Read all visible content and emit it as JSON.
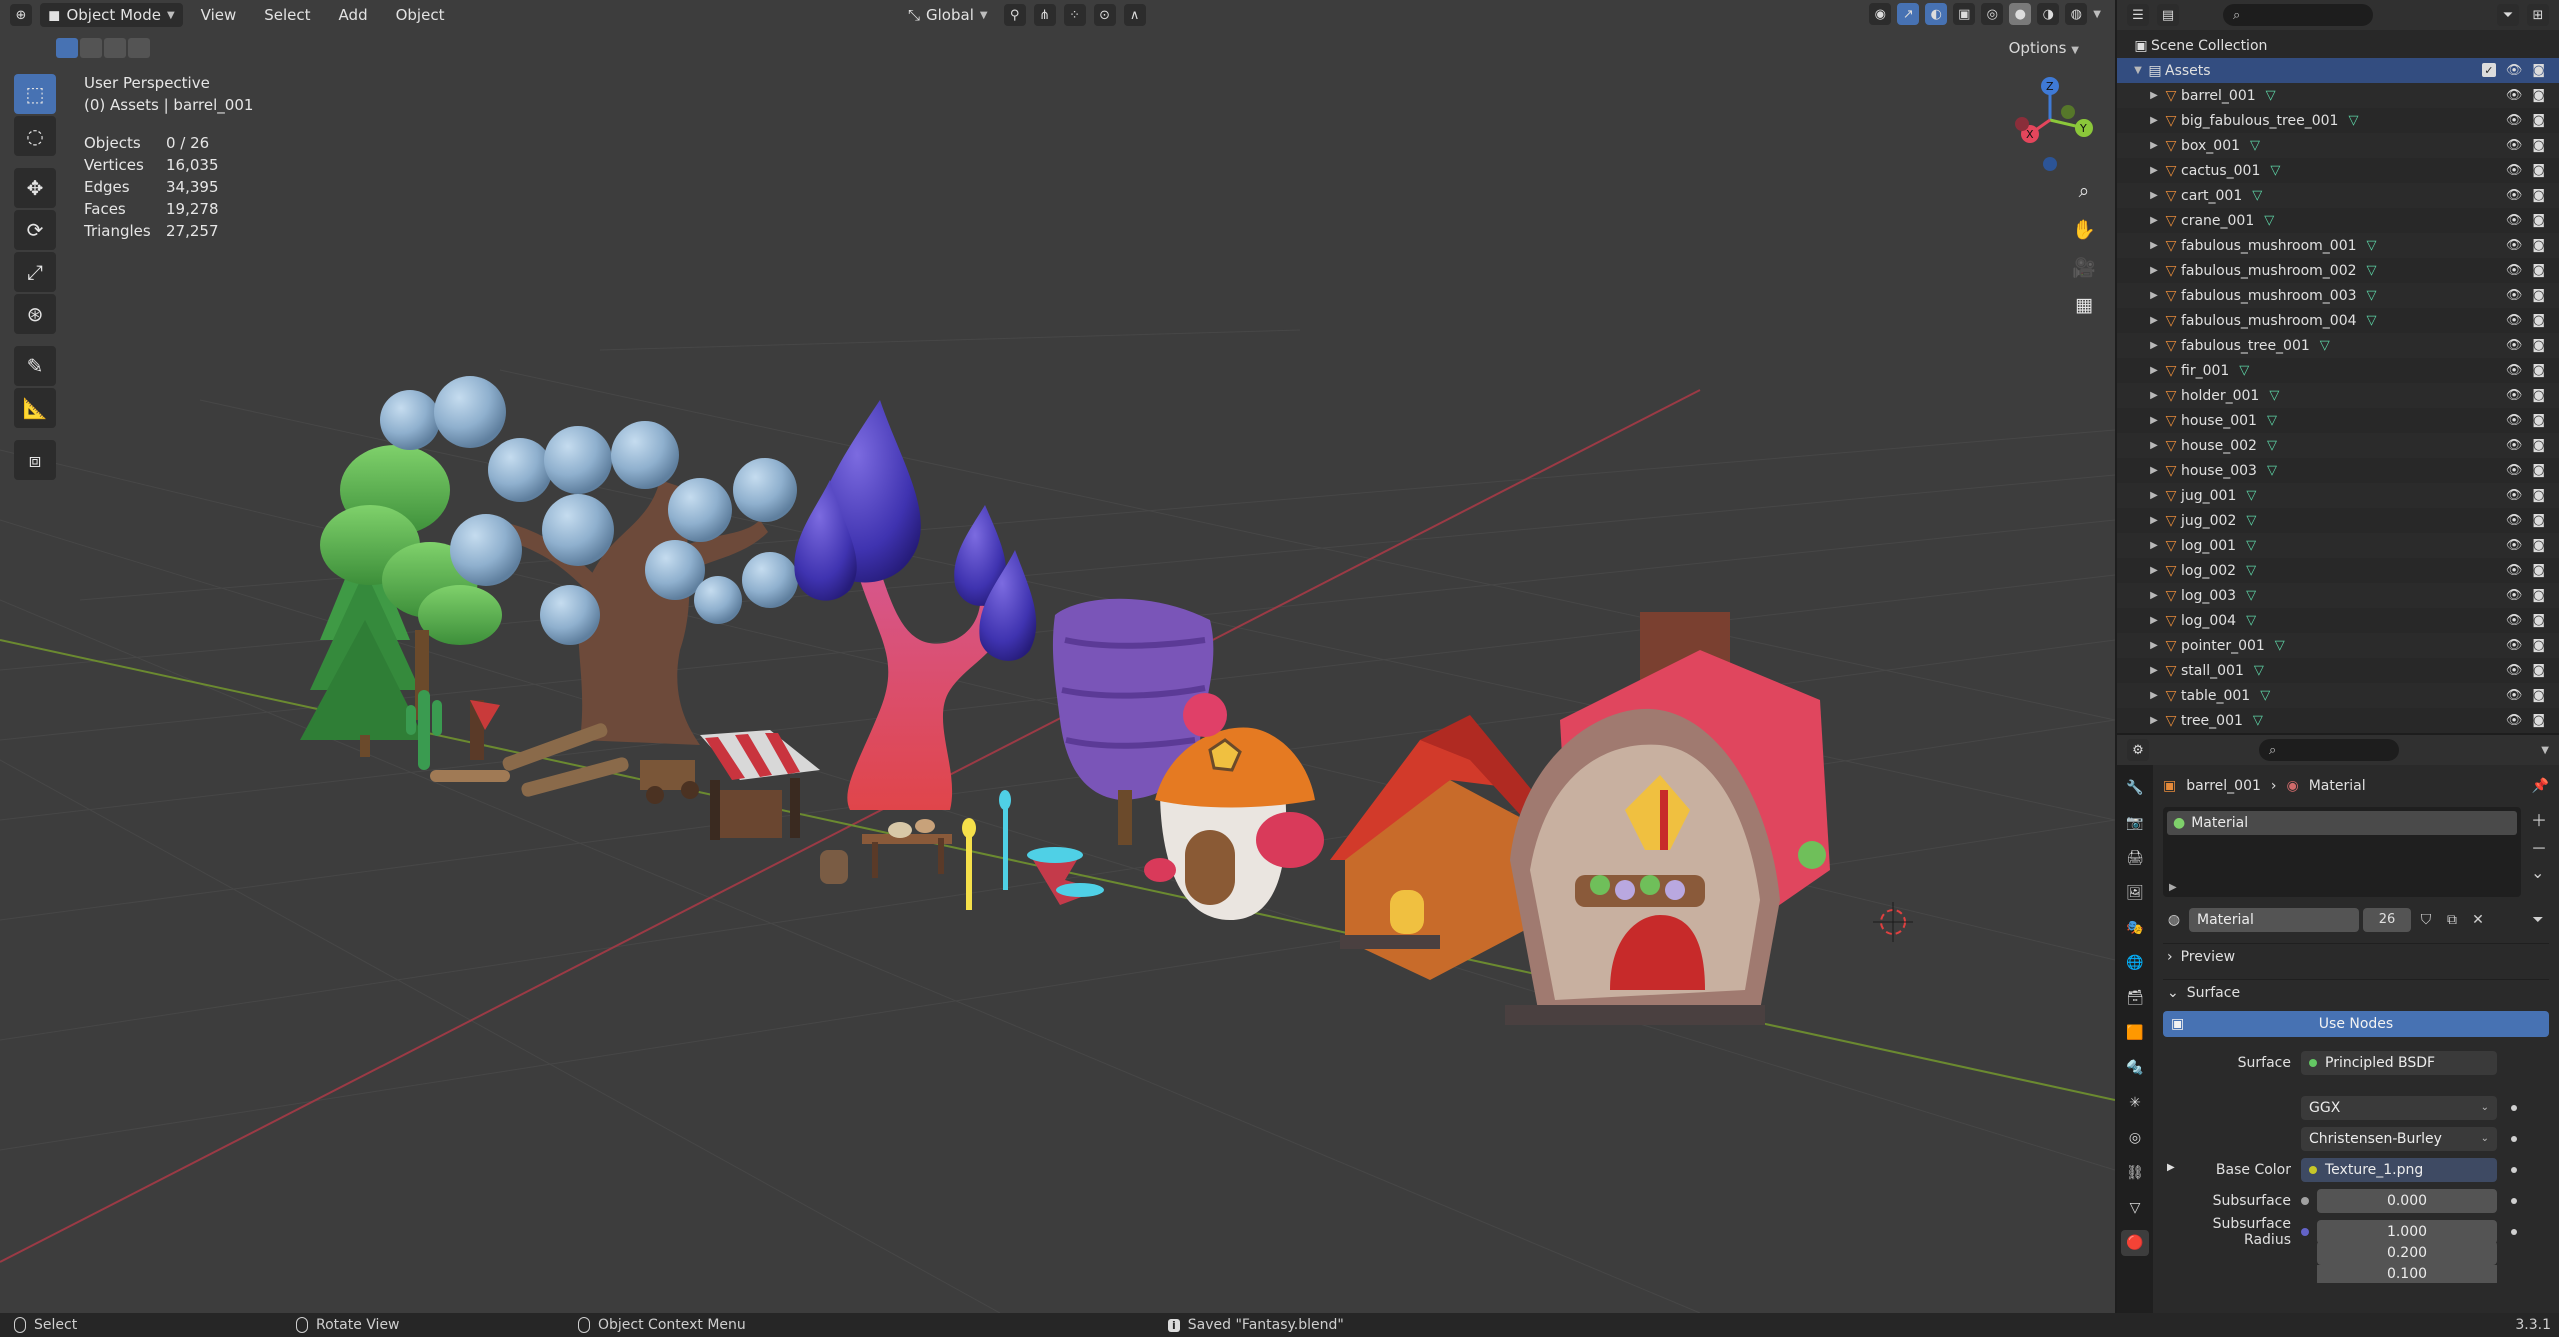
{
  "header": {
    "mode_label": "Object Mode",
    "menus": [
      "View",
      "Select",
      "Add",
      "Object"
    ],
    "orientation": "Global",
    "options_label": "Options"
  },
  "viewport": {
    "view_name": "User Perspective",
    "context": "(0) Assets | barrel_001",
    "stats": [
      {
        "label": "Objects",
        "value": "0 / 26"
      },
      {
        "label": "Vertices",
        "value": "16,035"
      },
      {
        "label": "Edges",
        "value": "34,395"
      },
      {
        "label": "Faces",
        "value": "19,278"
      },
      {
        "label": "Triangles",
        "value": "27,257"
      }
    ],
    "gizmo": {
      "x": "X",
      "y": "Y",
      "z": "Z"
    }
  },
  "outliner": {
    "scene_collection": "Scene Collection",
    "collection": "Assets",
    "objects": [
      "barrel_001",
      "big_fabulous_tree_001",
      "box_001",
      "cactus_001",
      "cart_001",
      "crane_001",
      "fabulous_mushroom_001",
      "fabulous_mushroom_002",
      "fabulous_mushroom_003",
      "fabulous_mushroom_004",
      "fabulous_tree_001",
      "fir_001",
      "holder_001",
      "house_001",
      "house_002",
      "house_003",
      "jug_001",
      "jug_002",
      "log_001",
      "log_002",
      "log_003",
      "log_004",
      "pointer_001",
      "stall_001",
      "table_001",
      "tree_001"
    ]
  },
  "properties": {
    "breadcrumb_object": "barrel_001",
    "breadcrumb_section": "Material",
    "slot_name": "Material",
    "material_name": "Material",
    "user_count": "26",
    "preview_label": "Preview",
    "surface_panel": "Surface",
    "use_nodes": "Use Nodes",
    "surface_label": "Surface",
    "surface_value": "Principled BSDF",
    "distribution": "GGX",
    "subsurface_method": "Christensen-Burley",
    "base_color_label": "Base Color",
    "base_color_value": "Texture_1.png",
    "subsurface_label": "Subsurface",
    "subsurface_value": "0.000",
    "subsurface_radius_label": "Subsurface Radius",
    "subsurface_radius": [
      "1.000",
      "0.200",
      "0.100"
    ]
  },
  "statusbar": {
    "left": "Select",
    "middle": "Rotate View",
    "context": "Object Context Menu",
    "message": "Saved \"Fantasy.blend\"",
    "version": "3.3.1"
  },
  "colors": {
    "accent": "#4772b3",
    "viewport_bg": "#3d3d3d",
    "axis_x": "#e4465c",
    "axis_y": "#8bc73a",
    "axis_z": "#3f7ad6"
  }
}
